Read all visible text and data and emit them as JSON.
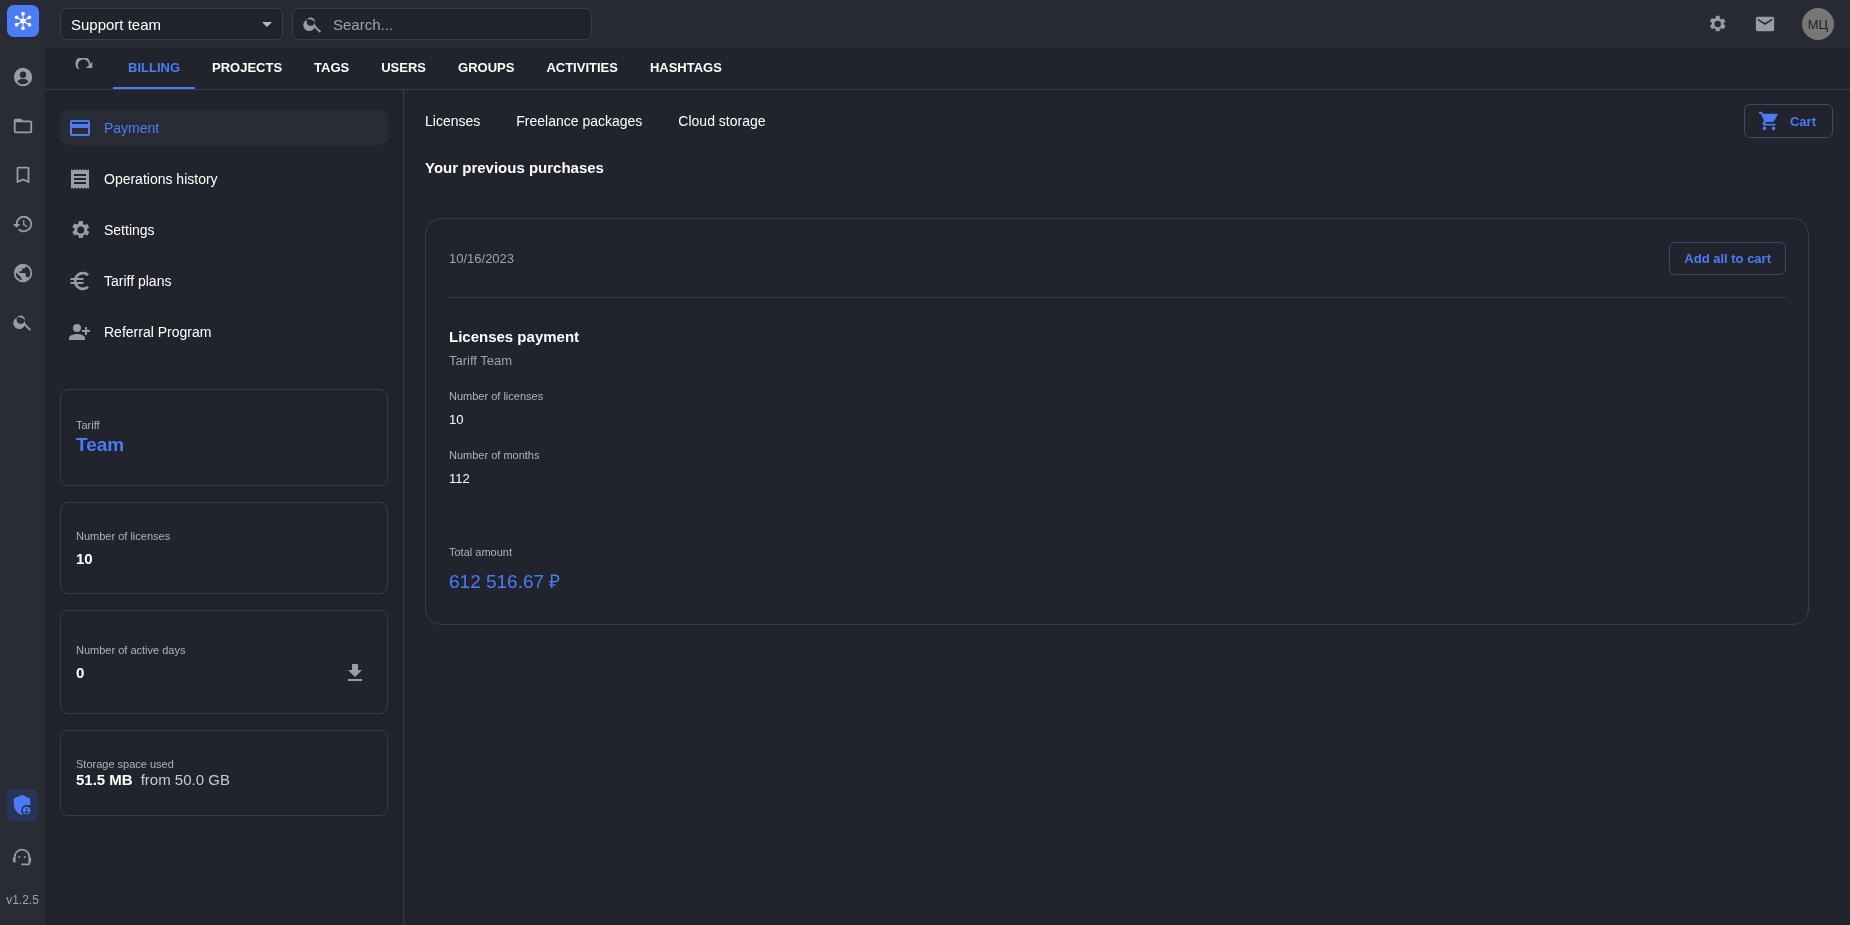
{
  "rail": {
    "top": [
      {
        "selected": false
      },
      {
        "selected": false
      },
      {
        "selected": false
      },
      {
        "selected": false
      },
      {
        "selected": false
      },
      {
        "selected": false
      }
    ],
    "bottom": [
      {
        "selected": true
      },
      {
        "selected": false
      }
    ],
    "version": "v1.2.5"
  },
  "topbar": {
    "team": "Support team",
    "search": {
      "placeholder": "Search..."
    },
    "avatar": "МЦ"
  },
  "tabs": [
    {
      "label": "BILLING",
      "selected": true
    },
    {
      "label": "PROJECTS",
      "selected": false
    },
    {
      "label": "TAGS",
      "selected": false
    },
    {
      "label": "USERS",
      "selected": false
    },
    {
      "label": "GROUPS",
      "selected": false
    },
    {
      "label": "ACTIVITIES",
      "selected": false
    },
    {
      "label": "HASHTAGS",
      "selected": false
    }
  ],
  "menu": [
    {
      "label": "Payment",
      "selected": true
    },
    {
      "label": "Operations history",
      "selected": false
    },
    {
      "label": "Settings",
      "selected": false
    },
    {
      "label": "Tariff plans",
      "selected": false
    },
    {
      "label": "Referral Program",
      "selected": false
    }
  ],
  "stats": [
    {
      "kind": "tariff",
      "label": "Tariff",
      "value": "Team"
    },
    {
      "kind": "count",
      "label": "Number of licenses",
      "value": "10"
    },
    {
      "kind": "download",
      "label": "Number of active days",
      "value": "0"
    },
    {
      "kind": "storage",
      "label": "Storage space used",
      "value": "51.5 MB",
      "extra": "from 50.0 GB"
    }
  ],
  "subtabs": [
    "Licenses",
    "Freelance packages",
    "Cloud storage"
  ],
  "cart": "Cart",
  "heading": "Your previous purchases",
  "purchase": {
    "date": "10/16/2023",
    "button": "Add all to cart",
    "title": "Licenses payment",
    "subtitle": "Tariff Team",
    "fields": [
      {
        "label": "Number of licenses",
        "value": "10"
      },
      {
        "label": "Number of months",
        "value": "112"
      }
    ],
    "total_label": "Total amount",
    "total": "612 516.67 ₽"
  }
}
